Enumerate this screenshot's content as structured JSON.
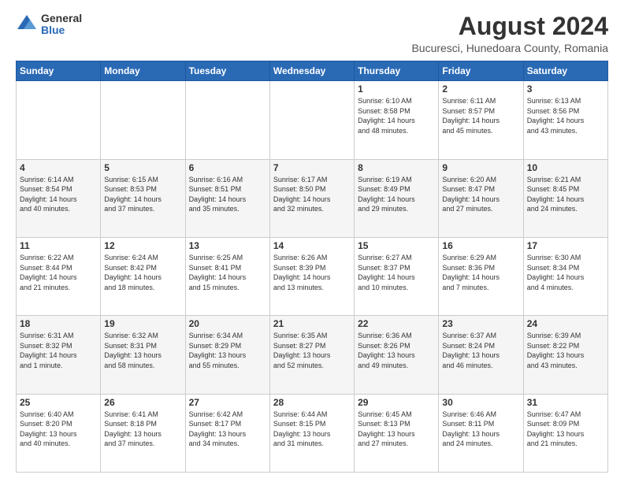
{
  "logo": {
    "general": "General",
    "blue": "Blue"
  },
  "title": "August 2024",
  "subtitle": "Bucuresci, Hunedoara County, Romania",
  "headers": [
    "Sunday",
    "Monday",
    "Tuesday",
    "Wednesday",
    "Thursday",
    "Friday",
    "Saturday"
  ],
  "weeks": [
    [
      {
        "day": "",
        "info": ""
      },
      {
        "day": "",
        "info": ""
      },
      {
        "day": "",
        "info": ""
      },
      {
        "day": "",
        "info": ""
      },
      {
        "day": "1",
        "info": "Sunrise: 6:10 AM\nSunset: 8:58 PM\nDaylight: 14 hours\nand 48 minutes."
      },
      {
        "day": "2",
        "info": "Sunrise: 6:11 AM\nSunset: 8:57 PM\nDaylight: 14 hours\nand 45 minutes."
      },
      {
        "day": "3",
        "info": "Sunrise: 6:13 AM\nSunset: 8:56 PM\nDaylight: 14 hours\nand 43 minutes."
      }
    ],
    [
      {
        "day": "4",
        "info": "Sunrise: 6:14 AM\nSunset: 8:54 PM\nDaylight: 14 hours\nand 40 minutes."
      },
      {
        "day": "5",
        "info": "Sunrise: 6:15 AM\nSunset: 8:53 PM\nDaylight: 14 hours\nand 37 minutes."
      },
      {
        "day": "6",
        "info": "Sunrise: 6:16 AM\nSunset: 8:51 PM\nDaylight: 14 hours\nand 35 minutes."
      },
      {
        "day": "7",
        "info": "Sunrise: 6:17 AM\nSunset: 8:50 PM\nDaylight: 14 hours\nand 32 minutes."
      },
      {
        "day": "8",
        "info": "Sunrise: 6:19 AM\nSunset: 8:49 PM\nDaylight: 14 hours\nand 29 minutes."
      },
      {
        "day": "9",
        "info": "Sunrise: 6:20 AM\nSunset: 8:47 PM\nDaylight: 14 hours\nand 27 minutes."
      },
      {
        "day": "10",
        "info": "Sunrise: 6:21 AM\nSunset: 8:45 PM\nDaylight: 14 hours\nand 24 minutes."
      }
    ],
    [
      {
        "day": "11",
        "info": "Sunrise: 6:22 AM\nSunset: 8:44 PM\nDaylight: 14 hours\nand 21 minutes."
      },
      {
        "day": "12",
        "info": "Sunrise: 6:24 AM\nSunset: 8:42 PM\nDaylight: 14 hours\nand 18 minutes."
      },
      {
        "day": "13",
        "info": "Sunrise: 6:25 AM\nSunset: 8:41 PM\nDaylight: 14 hours\nand 15 minutes."
      },
      {
        "day": "14",
        "info": "Sunrise: 6:26 AM\nSunset: 8:39 PM\nDaylight: 14 hours\nand 13 minutes."
      },
      {
        "day": "15",
        "info": "Sunrise: 6:27 AM\nSunset: 8:37 PM\nDaylight: 14 hours\nand 10 minutes."
      },
      {
        "day": "16",
        "info": "Sunrise: 6:29 AM\nSunset: 8:36 PM\nDaylight: 14 hours\nand 7 minutes."
      },
      {
        "day": "17",
        "info": "Sunrise: 6:30 AM\nSunset: 8:34 PM\nDaylight: 14 hours\nand 4 minutes."
      }
    ],
    [
      {
        "day": "18",
        "info": "Sunrise: 6:31 AM\nSunset: 8:32 PM\nDaylight: 14 hours\nand 1 minute."
      },
      {
        "day": "19",
        "info": "Sunrise: 6:32 AM\nSunset: 8:31 PM\nDaylight: 13 hours\nand 58 minutes."
      },
      {
        "day": "20",
        "info": "Sunrise: 6:34 AM\nSunset: 8:29 PM\nDaylight: 13 hours\nand 55 minutes."
      },
      {
        "day": "21",
        "info": "Sunrise: 6:35 AM\nSunset: 8:27 PM\nDaylight: 13 hours\nand 52 minutes."
      },
      {
        "day": "22",
        "info": "Sunrise: 6:36 AM\nSunset: 8:26 PM\nDaylight: 13 hours\nand 49 minutes."
      },
      {
        "day": "23",
        "info": "Sunrise: 6:37 AM\nSunset: 8:24 PM\nDaylight: 13 hours\nand 46 minutes."
      },
      {
        "day": "24",
        "info": "Sunrise: 6:39 AM\nSunset: 8:22 PM\nDaylight: 13 hours\nand 43 minutes."
      }
    ],
    [
      {
        "day": "25",
        "info": "Sunrise: 6:40 AM\nSunset: 8:20 PM\nDaylight: 13 hours\nand 40 minutes."
      },
      {
        "day": "26",
        "info": "Sunrise: 6:41 AM\nSunset: 8:18 PM\nDaylight: 13 hours\nand 37 minutes."
      },
      {
        "day": "27",
        "info": "Sunrise: 6:42 AM\nSunset: 8:17 PM\nDaylight: 13 hours\nand 34 minutes."
      },
      {
        "day": "28",
        "info": "Sunrise: 6:44 AM\nSunset: 8:15 PM\nDaylight: 13 hours\nand 31 minutes."
      },
      {
        "day": "29",
        "info": "Sunrise: 6:45 AM\nSunset: 8:13 PM\nDaylight: 13 hours\nand 27 minutes."
      },
      {
        "day": "30",
        "info": "Sunrise: 6:46 AM\nSunset: 8:11 PM\nDaylight: 13 hours\nand 24 minutes."
      },
      {
        "day": "31",
        "info": "Sunrise: 6:47 AM\nSunset: 8:09 PM\nDaylight: 13 hours\nand 21 minutes."
      }
    ]
  ]
}
